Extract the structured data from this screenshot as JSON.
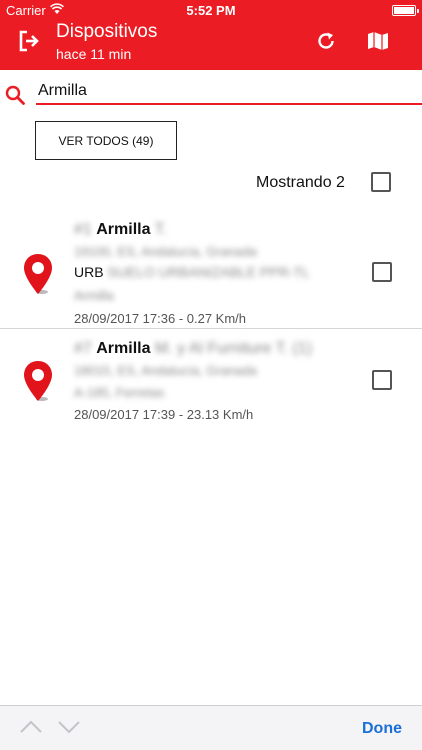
{
  "status_bar": {
    "carrier": "Carrier",
    "time": "5:52 PM"
  },
  "header": {
    "title": "Dispositivos",
    "subtitle": "hace 11 min",
    "background_color": "#ec1c24"
  },
  "search": {
    "value": "Armilla",
    "accent_color": "#ec1c24"
  },
  "ver_todos_label": "VER TODOS (49)",
  "mostrando_label": "Mostrando 2",
  "devices": [
    {
      "name_prefix": "#1",
      "name": "Armilla",
      "name_suffix": "T.",
      "address_blur": "19100, ES, Andalucía, Granada",
      "urb_label": "URB",
      "urb_detail": "SUELO URBANIZABLE PPR-TL",
      "extra_blur": "Armilla",
      "timestamp": "28/09/2017 17:36 - 0.27 Km/h"
    },
    {
      "name_prefix": "#7",
      "name": "Armilla",
      "name_suffix": "M. y Al Furniture T. (1)",
      "address_blur": "18015, ES, Andalucía, Granada",
      "extra_blur": "A-185, Ferretas",
      "timestamp": "28/09/2017 17:39 - 23.13 Km/h"
    }
  ],
  "bottom_bar": {
    "done_label": "Done",
    "link_color": "#1a6fd6"
  },
  "icons": [
    "exit-icon",
    "refresh-icon",
    "map-icon",
    "search-icon",
    "location-pin-icon",
    "chevron-up-icon",
    "chevron-down-icon",
    "wifi-icon",
    "battery-icon"
  ]
}
